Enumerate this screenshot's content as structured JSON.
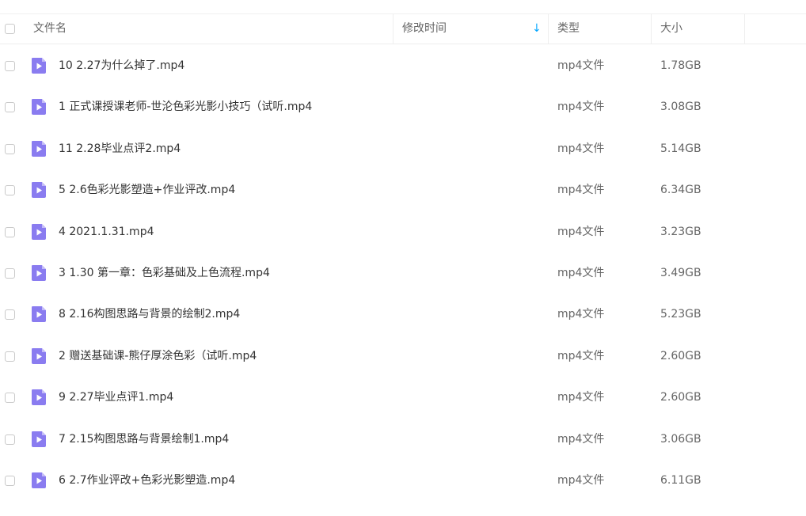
{
  "header": {
    "name_label": "文件名",
    "modified_label": "修改时间",
    "sort_arrow": "↓",
    "type_label": "类型",
    "size_label": "大小"
  },
  "colors": {
    "accent": "#06a7ff",
    "file_icon": "#8a7cf0"
  },
  "files": [
    {
      "name": "10 2.27为什么掉了.mp4",
      "type": "mp4文件",
      "size": "1.78GB",
      "icon": "video-file-icon"
    },
    {
      "name": "1 正式课授课老师-世沦色彩光影小技巧（试听.mp4",
      "type": "mp4文件",
      "size": "3.08GB",
      "icon": "video-file-icon"
    },
    {
      "name": "11 2.28毕业点评2.mp4",
      "type": "mp4文件",
      "size": "5.14GB",
      "icon": "video-file-icon"
    },
    {
      "name": "5 2.6色彩光影塑造+作业评改.mp4",
      "type": "mp4文件",
      "size": "6.34GB",
      "icon": "video-file-icon"
    },
    {
      "name": "4 2021.1.31.mp4",
      "type": "mp4文件",
      "size": "3.23GB",
      "icon": "video-file-icon"
    },
    {
      "name": "3 1.30 第一章：色彩基础及上色流程.mp4",
      "type": "mp4文件",
      "size": "3.49GB",
      "icon": "video-file-icon"
    },
    {
      "name": "8 2.16构图思路与背景的绘制2.mp4",
      "type": "mp4文件",
      "size": "5.23GB",
      "icon": "video-file-icon"
    },
    {
      "name": "2 赠送基础课-熊仔厚涂色彩（试听.mp4",
      "type": "mp4文件",
      "size": "2.60GB",
      "icon": "video-file-icon"
    },
    {
      "name": "9 2.27毕业点评1.mp4",
      "type": "mp4文件",
      "size": "2.60GB",
      "icon": "video-file-icon"
    },
    {
      "name": "7 2.15构图思路与背景绘制1.mp4",
      "type": "mp4文件",
      "size": "3.06GB",
      "icon": "video-file-icon"
    },
    {
      "name": "6 2.7作业评改+色彩光影塑造.mp4",
      "type": "mp4文件",
      "size": "6.11GB",
      "icon": "video-file-icon"
    }
  ]
}
